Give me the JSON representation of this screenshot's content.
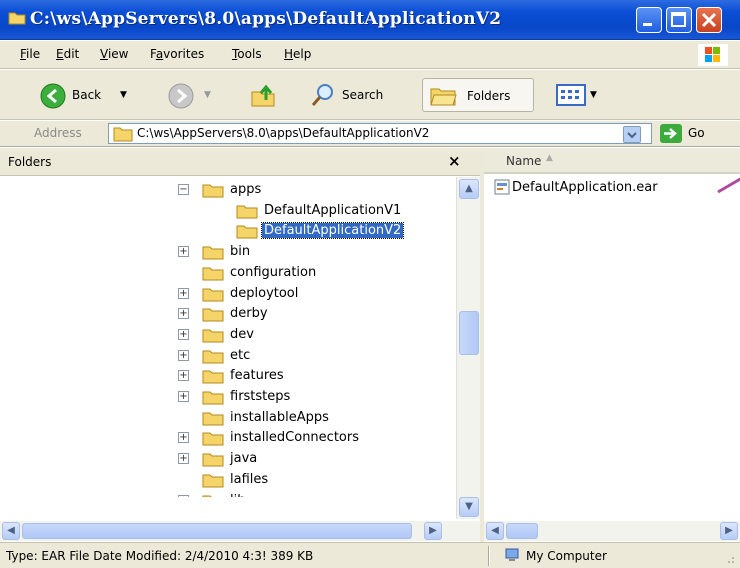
{
  "window": {
    "title": "C:\\ws\\AppServers\\8.0\\apps\\DefaultApplicationV2",
    "title_color": "#0a4fd6",
    "buttons": [
      "minimize",
      "maximize",
      "close"
    ]
  },
  "menubar": {
    "items": [
      {
        "label": "File",
        "accel": "F"
      },
      {
        "label": "Edit",
        "accel": "E"
      },
      {
        "label": "View",
        "accel": "V"
      },
      {
        "label": "Favorites",
        "accel": "a"
      },
      {
        "label": "Tools",
        "accel": "T"
      },
      {
        "label": "Help",
        "accel": "H"
      }
    ]
  },
  "toolbar": {
    "back_label": "Back",
    "search_label": "Search",
    "folders_label": "Folders"
  },
  "address": {
    "label": "Address",
    "value": "C:\\ws\\AppServers\\8.0\\apps\\DefaultApplicationV2",
    "go_label": "Go"
  },
  "folders_pane": {
    "title": "Folders",
    "close_glyph": "×",
    "tree": [
      {
        "label": "apps",
        "expander": "minus",
        "level": 0
      },
      {
        "label": "DefaultApplicationV1",
        "expander": "none",
        "level": 1
      },
      {
        "label": "DefaultApplicationV2",
        "expander": "none",
        "level": 1,
        "selected": true
      },
      {
        "label": "bin",
        "expander": "plus",
        "level": 0
      },
      {
        "label": "configuration",
        "expander": "none",
        "level": 0
      },
      {
        "label": "deploytool",
        "expander": "plus",
        "level": 0
      },
      {
        "label": "derby",
        "expander": "plus",
        "level": 0
      },
      {
        "label": "dev",
        "expander": "plus",
        "level": 0
      },
      {
        "label": "etc",
        "expander": "plus",
        "level": 0
      },
      {
        "label": "features",
        "expander": "plus",
        "level": 0
      },
      {
        "label": "firststeps",
        "expander": "plus",
        "level": 0
      },
      {
        "label": "installableApps",
        "expander": "none",
        "level": 0
      },
      {
        "label": "installedConnectors",
        "expander": "plus",
        "level": 0
      },
      {
        "label": "java",
        "expander": "plus",
        "level": 0
      },
      {
        "label": "lafiles",
        "expander": "none",
        "level": 0
      },
      {
        "label": "lib",
        "expander": "plus",
        "level": 0
      }
    ]
  },
  "file_list": {
    "column_name": "Name",
    "sort_glyph": "▲",
    "files": [
      {
        "name": "DefaultApplication.ear"
      }
    ]
  },
  "statusbar": {
    "info": "Type: EAR File Date Modified: 2/4/2010 4:3! 389 KB",
    "zone": "My Computer"
  },
  "colors": {
    "xp_blue": "#0a4fd6",
    "selection": "#316ac5",
    "chrome": "#ece9d8",
    "folder_yellow": "#f5d56a"
  }
}
